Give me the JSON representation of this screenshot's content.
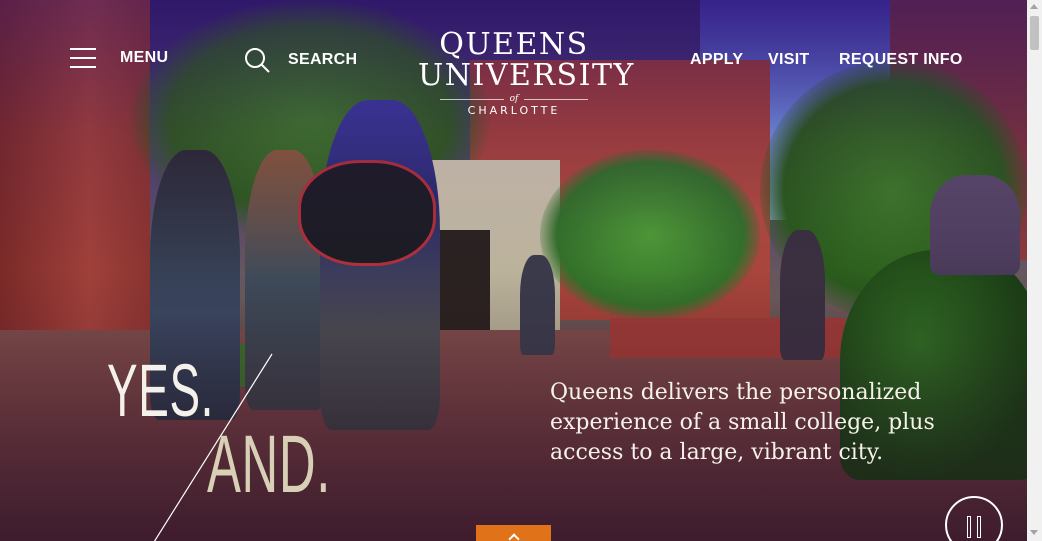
{
  "header": {
    "menu_label": "MENU",
    "search_label": "SEARCH",
    "logo": {
      "line1": "QUEENS",
      "line2": "UNIVERSITY",
      "of": "of",
      "line3": "CHARLOTTE"
    },
    "links": {
      "apply": "APPLY",
      "visit": "VISIT",
      "request_info": "REQUEST INFO"
    }
  },
  "hero": {
    "headline_1": "YES.",
    "headline_2": "AND.",
    "tagline": "Queens delivers the personalized experience of a small college, plus access to a large, vibrant city."
  },
  "icons": {
    "menu": "hamburger-icon",
    "search": "search-icon",
    "pause": "pause-icon",
    "cta": "chevron-up-icon"
  },
  "colors": {
    "accent": "#e0731a",
    "text": "#ffffff",
    "headline": "#f4f1ea",
    "headline_secondary": "#d8d0b6"
  }
}
